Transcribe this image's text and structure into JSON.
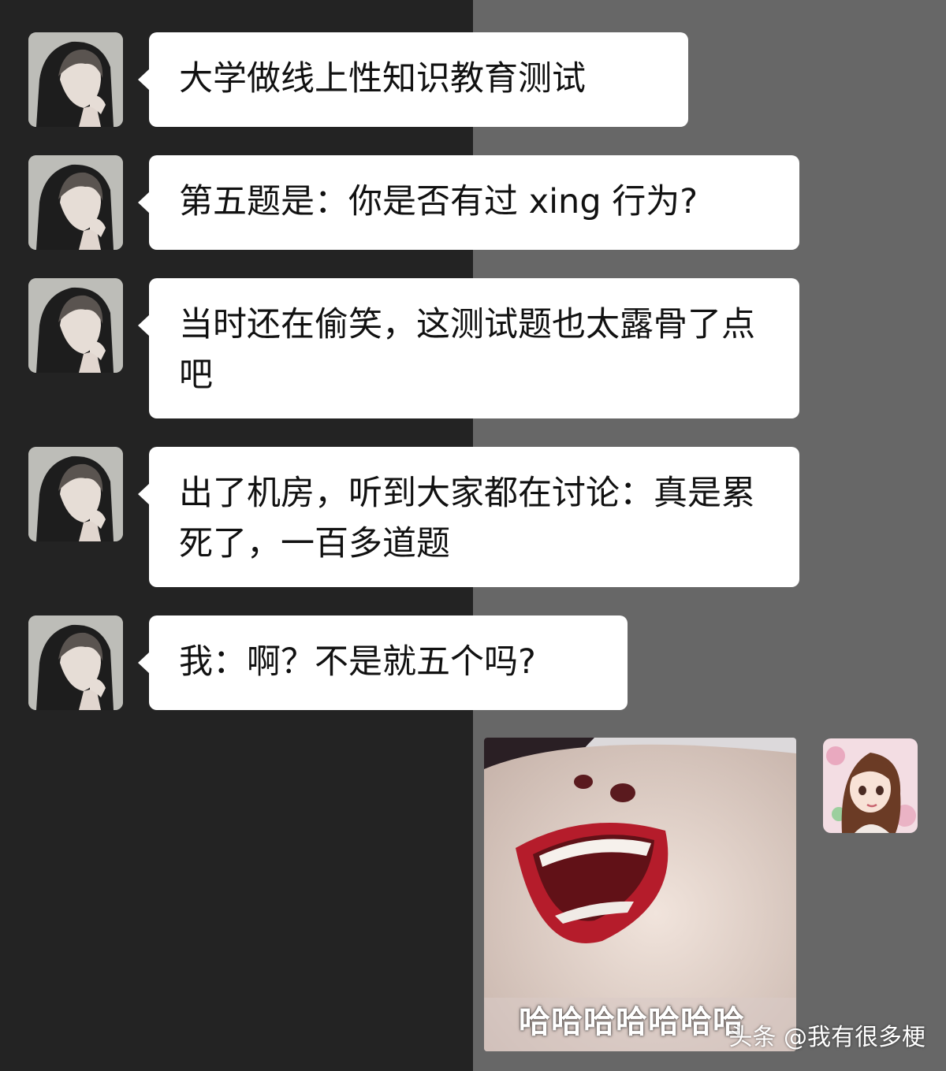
{
  "messages": [
    {
      "text": "大学做线上性知识教育测试",
      "avatar": "male-anime-avatar"
    },
    {
      "text": "第五题是：你是否有过 xing 行为?",
      "avatar": "male-anime-avatar"
    },
    {
      "text": "当时还在偷笑，这测试题也太露骨了点吧",
      "avatar": "male-anime-avatar"
    },
    {
      "text": "出了机房，听到大家都在讨论：真是累死了，一百多道题",
      "avatar": "male-anime-avatar"
    },
    {
      "text": "我：啊？不是就五个吗?",
      "avatar": "male-anime-avatar"
    }
  ],
  "reply": {
    "sticker_caption": "哈哈哈哈哈哈哈",
    "avatar": "female-anime-avatar"
  },
  "watermark": "头条 @我有很多梗",
  "colors": {
    "left_background": "#232323",
    "right_background": "#676767",
    "bubble": "#ffffff"
  }
}
